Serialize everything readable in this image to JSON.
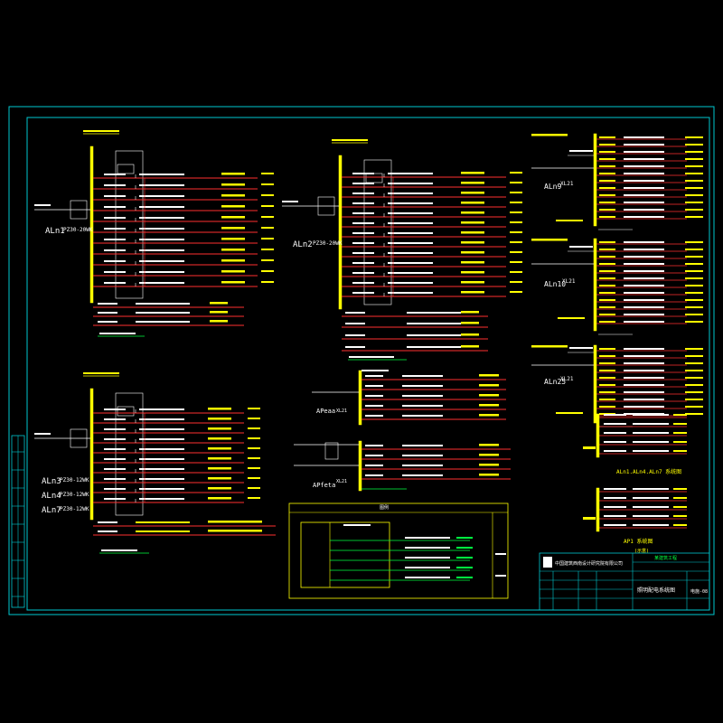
{
  "colors": {
    "background": "#000000",
    "frame": "#00c8d0",
    "bus": "#ffff00",
    "feeder": "#ff3030",
    "label": "#ffffff",
    "device": "#ffffff",
    "annotation": "#ffff00",
    "green": "#00ff40",
    "cyan": "#00c8d0"
  },
  "panels": {
    "aln1": {
      "tag": "ALn1",
      "rating": "PZ30-20WK"
    },
    "aln2": {
      "tag": "ALn2",
      "rating": "PZ30-20WK"
    },
    "alh3_tags": [
      "ALn3",
      "ALn4",
      "ALn7"
    ],
    "alh3_ratings": [
      "PZ30-12WK",
      "PZ30-12WK",
      "PZ30-12WK"
    ],
    "aln9": {
      "tag": "ALn9",
      "rating": "XL21"
    },
    "aln10": {
      "tag": "ALn10",
      "rating": "XL21"
    },
    "aln25": {
      "tag": "ALn25",
      "rating": "XL21"
    },
    "apeaa": {
      "tag": "APeaa",
      "rating": "XL21"
    },
    "apfeta": {
      "tag": "APfeta",
      "rating": "XL21"
    }
  },
  "notes": {
    "series_title": "ALn1.ALn4.ALn7 系统图",
    "ap_title": "AP1 系统图",
    "ap_sub": "(示意)",
    "legend_header": "图例"
  },
  "title_block": {
    "company": "中国建筑西南设计研究院有限公司",
    "drawing_title": "照明配电系统图",
    "project": "某建筑工程",
    "sheet": "电施-08"
  }
}
